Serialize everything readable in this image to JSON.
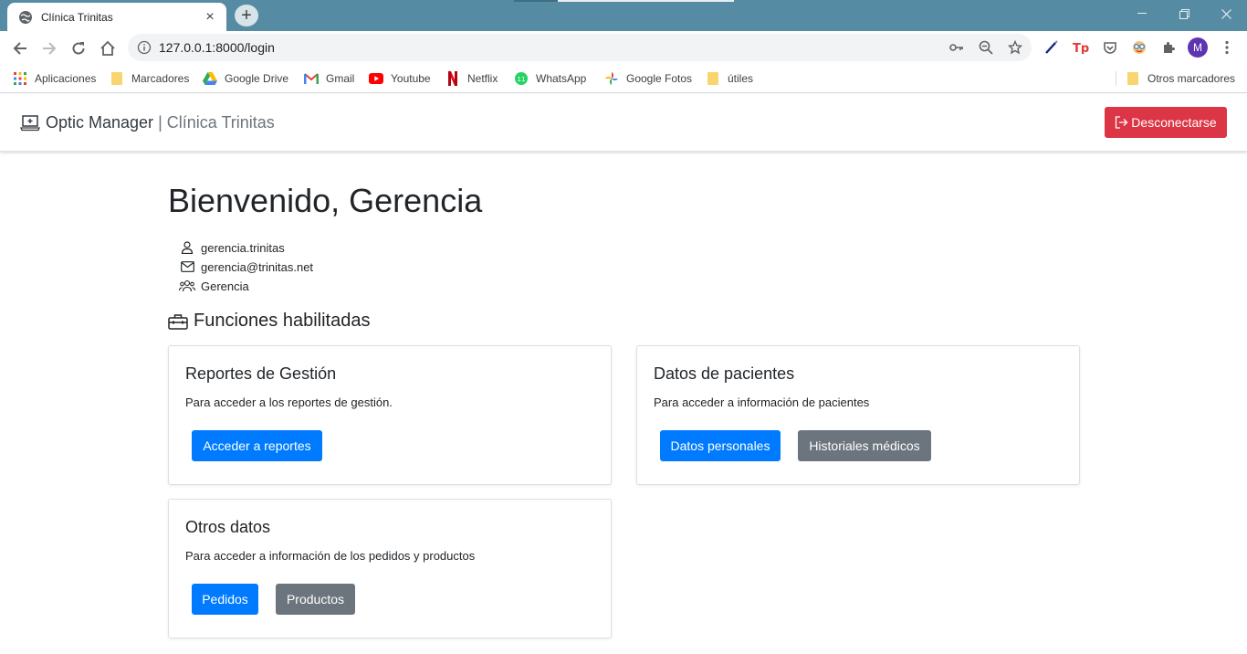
{
  "browser": {
    "tab_title": "Clínica Trinitas",
    "url": "127.0.0.1:8000/login",
    "profile_initial": "M",
    "bookmarks": [
      {
        "label": "Aplicaciones",
        "icon": "apps-grid-icon"
      },
      {
        "label": "Marcadores",
        "icon": "folder-icon"
      },
      {
        "label": "Google Drive",
        "icon": "google-drive-icon"
      },
      {
        "label": "Gmail",
        "icon": "gmail-icon"
      },
      {
        "label": "Youtube",
        "icon": "youtube-icon"
      },
      {
        "label": "Netflix",
        "icon": "netflix-icon"
      },
      {
        "label": "WhatsApp",
        "icon": "whatsapp-icon"
      },
      {
        "label": "Google Fotos",
        "icon": "google-photos-icon"
      },
      {
        "label": "útiles",
        "icon": "folder-icon"
      },
      {
        "label": "Otros marcadores",
        "icon": "folder-icon"
      }
    ]
  },
  "navbar": {
    "app_name": "Optic Manager",
    "separator": "|",
    "clinic_name": "Clínica Trinitas",
    "logout_label": "Desconectarse"
  },
  "main": {
    "welcome": "Bienvenido, Gerencia",
    "user": {
      "username": "gerencia.trinitas",
      "email": "gerencia@trinitas.net",
      "role": "Gerencia"
    },
    "section_title": "Funciones habilitadas",
    "cards": [
      {
        "title": "Reportes de Gestión",
        "text": "Para acceder a los reportes de gestión.",
        "buttons": [
          "Acceder a reportes"
        ]
      },
      {
        "title": "Datos de pacientes",
        "text": "Para acceder a información de pacientes",
        "buttons": [
          "Datos personales",
          "Historiales médicos"
        ]
      },
      {
        "title": "Otros datos",
        "text": "Para acceder a información de los pedidos y productos",
        "buttons": [
          "Pedidos",
          "Productos"
        ]
      }
    ]
  },
  "colors": {
    "titlebar": "#568ca3",
    "danger": "#dc3545",
    "primary": "#007bff",
    "secondary": "#6c757d"
  }
}
